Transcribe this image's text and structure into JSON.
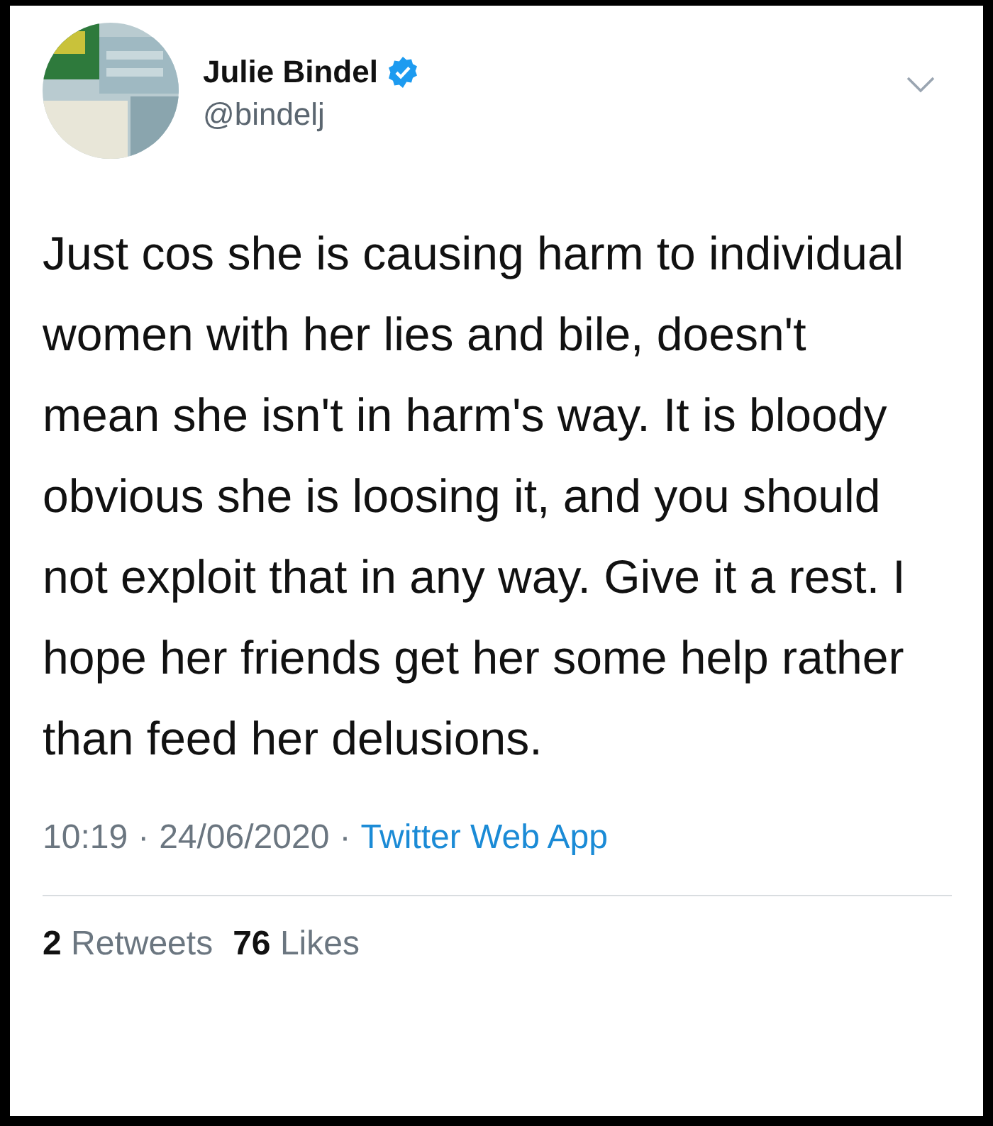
{
  "tweet": {
    "author": {
      "name": "Julie Bindel",
      "handle": "@bindelj",
      "verified": true
    },
    "text": "Just cos she is causing harm to individual women with her lies and bile, doesn't mean she isn't in harm's way. It is bloody obvious she is loosing it, and you should not exploit that in any way. Give it a rest. I hope her friends get her some help rather than feed her delusions.",
    "time": "10:19",
    "separator": "·",
    "date": "24/06/2020",
    "source": "Twitter Web App",
    "stats": [
      {
        "count": "2",
        "label": "Retweets"
      },
      {
        "count": "76",
        "label": "Likes"
      }
    ]
  }
}
